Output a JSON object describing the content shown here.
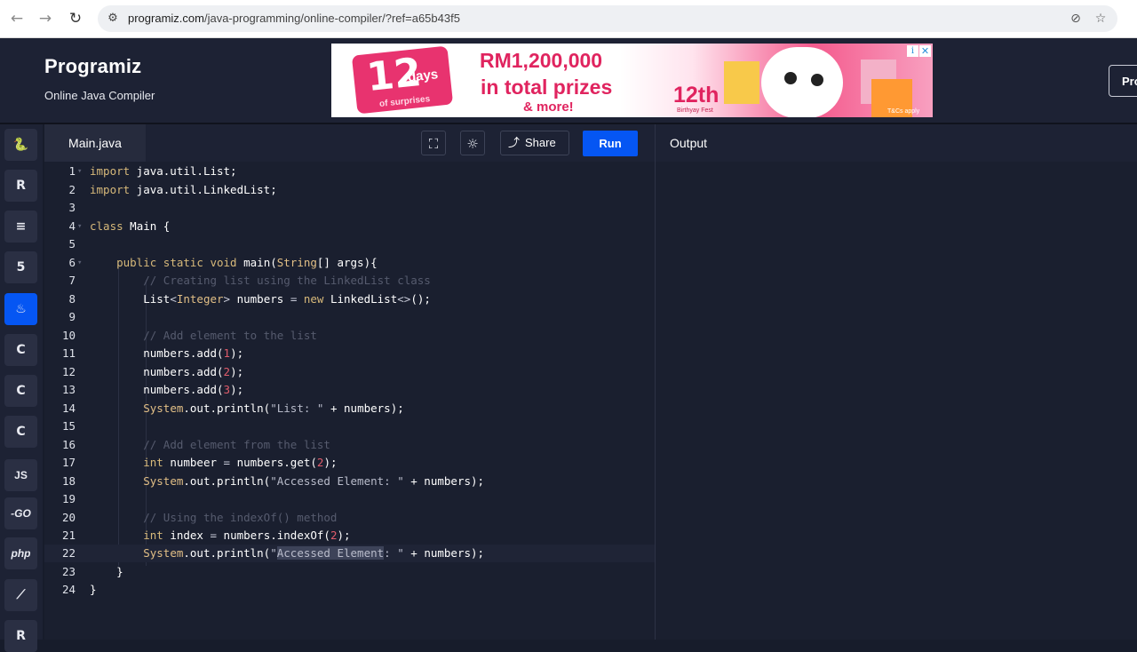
{
  "browser": {
    "back_icon": "arrow-left-icon",
    "url_host": "programiz.com",
    "url_path": "/java-programming/online-compiler/?ref=a65b43f5"
  },
  "header": {
    "logo": "Programiz",
    "subtitle": "Online Java Compiler",
    "pro_button": "Pro"
  },
  "ad": {
    "badge_number": "12",
    "badge_days": "days",
    "badge_sub": "of surprises",
    "line1": "RM1,200,000",
    "line2": "in total prizes",
    "line3": "& more!",
    "fest_number": "12th",
    "fest_label": "Birthyay Fest",
    "tc": "T&Cs apply"
  },
  "sidebar": {
    "languages": [
      {
        "name": "python",
        "label": "🐍"
      },
      {
        "name": "r",
        "label": "R"
      },
      {
        "name": "sql",
        "label": "≡"
      },
      {
        "name": "html",
        "label": "5"
      },
      {
        "name": "java",
        "label": "♨"
      },
      {
        "name": "c",
        "label": "C"
      },
      {
        "name": "cpp",
        "label": "C"
      },
      {
        "name": "csharp",
        "label": "C"
      },
      {
        "name": "js",
        "label": "JS"
      },
      {
        "name": "go",
        "label": "-GO"
      },
      {
        "name": "php",
        "label": "php"
      },
      {
        "name": "swift",
        "label": "⟋"
      },
      {
        "name": "rust",
        "label": "R"
      }
    ]
  },
  "editor": {
    "tab": "Main.java",
    "share": "Share",
    "run": "Run",
    "line_numbers": [
      "1",
      "2",
      "3",
      "4",
      "5",
      "6",
      "7",
      "8",
      "9",
      "10",
      "11",
      "12",
      "13",
      "14",
      "15",
      "16",
      "17",
      "18",
      "19",
      "20",
      "21",
      "22",
      "23",
      "24"
    ],
    "code": {
      "l1_kw": "import",
      "l1_rest": " java.util.List;",
      "l2_kw": "import",
      "l2_rest": " java.util.LinkedList;",
      "l4_kw": "class",
      "l4_rest": " Main {",
      "l6_kw1": "public",
      "l6_kw2": "static",
      "l6_kw3": "void",
      "l6_name": " main(",
      "l6_type": "String",
      "l6_rest": "[] args){",
      "l7_comment": "// Creating list using the LinkedList class",
      "l8_a": "List",
      "l8_b": "<",
      "l8_type": "Integer",
      "l8_c": ">",
      "l8_d": " numbers ",
      "l8_eq": "=",
      "l8_sp": " ",
      "l8_new": "new",
      "l8_e": " LinkedList",
      "l8_f": "<>",
      "l8_g": "();",
      "l10_comment": "// Add element to the list",
      "l11_a": "numbers.add(",
      "l11_n": "1",
      "l11_b": ");",
      "l12_a": "numbers.add(",
      "l12_n": "2",
      "l12_b": ");",
      "l13_a": "numbers.add(",
      "l13_n": "3",
      "l13_b": ");",
      "l14_a": "System",
      "l14_b": ".out.println(",
      "l14_s": "\"List: \"",
      "l14_c": " + numbers);",
      "l16_comment": "// Add element from the list",
      "l17_kw": "int",
      "l17_a": " numbeer ",
      "l17_eq": "=",
      "l17_b": " numbers.get(",
      "l17_n": "2",
      "l17_c": ");",
      "l18_a": "System",
      "l18_b": ".out.println(",
      "l18_s": "\"Accessed Element: \"",
      "l18_c": " + numbers);",
      "l20_comment": "// Using the indexOf() method",
      "l21_kw": "int",
      "l21_a": " index ",
      "l21_eq": "=",
      "l21_b": " numbers.indexOf(",
      "l21_n": "2",
      "l21_c": ");",
      "l22_a": "System",
      "l22_b": ".out.println(",
      "l22_q": "\"",
      "l22_sel": "Accessed Element",
      "l22_s2": ": \"",
      "l22_c": " + numbers);",
      "l23": "}",
      "l24": "}"
    }
  },
  "output": {
    "title": "Output"
  }
}
